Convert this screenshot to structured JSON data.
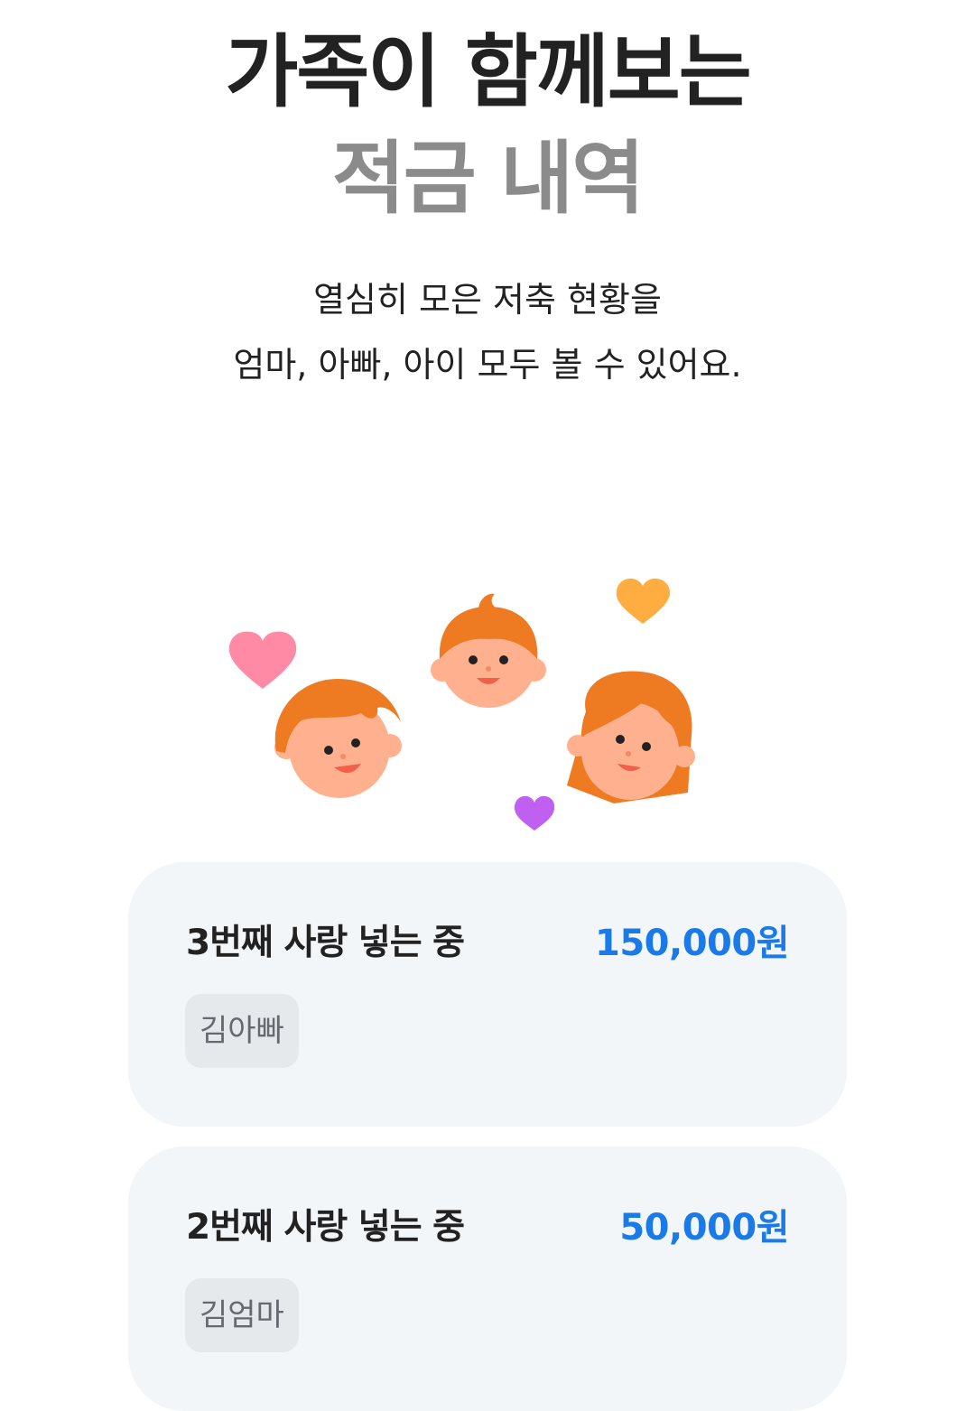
{
  "header": {
    "title_line1": "가족이 함께보는",
    "title_line2": "적금 내역",
    "subtitle_line1": "열심히 모은 저축 현황을",
    "subtitle_line2": "엄마, 아빠, 아이 모두 볼 수 있어요."
  },
  "illustration": {
    "icons": [
      "dad-face-icon",
      "baby-face-icon",
      "mom-face-icon",
      "pink-heart-icon",
      "orange-heart-icon",
      "purple-heart-icon"
    ],
    "colors": {
      "hair": "#ee7a22",
      "skin": "#ffb08f",
      "pink_heart": "#ff8aa6",
      "orange_heart": "#ffad40",
      "purple_heart": "#c060f0"
    }
  },
  "deposits": [
    {
      "title": "3번째 사랑 넣는 중",
      "amount": "150,000원",
      "member": "김아빠"
    },
    {
      "title": "2번째 사랑 넣는 중",
      "amount": "50,000원",
      "member": "김엄마"
    }
  ],
  "colors": {
    "accent": "#1a7ae8",
    "card_bg": "#f2f6f9",
    "tag_bg": "#e6e9eb"
  }
}
